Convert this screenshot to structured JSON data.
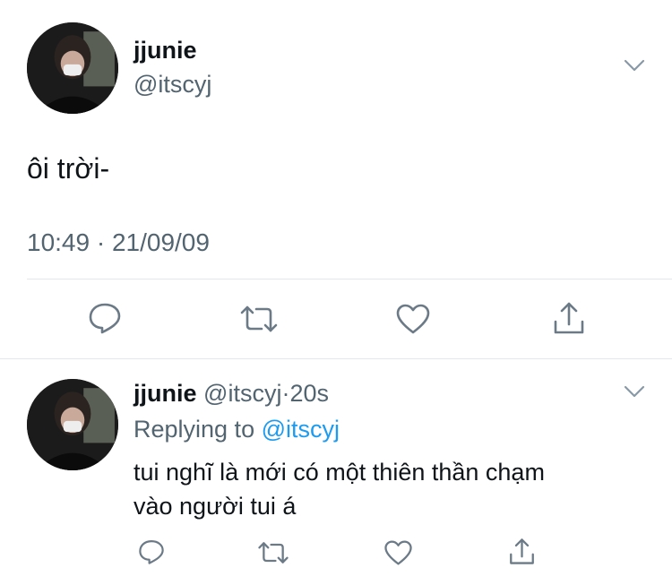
{
  "tweet": {
    "display_name": "jjunie",
    "handle": "@itscyj",
    "text": "ôi trời-",
    "timestamp": "10:49 · 21/09/09",
    "actions": [
      "reply-icon",
      "retweet-icon",
      "like-icon",
      "share-icon"
    ]
  },
  "reply": {
    "display_name": "jjunie",
    "handle": "@itscyj",
    "separator": "·",
    "time_ago": "20s",
    "replying_prefix": "Replying to",
    "replying_to": "@itscyj",
    "text_line1": "tui nghĩ là mới có một thiên thần chạm",
    "text_line2": "vào người tui á",
    "actions": [
      "reply-icon",
      "retweet-icon",
      "like-icon",
      "share-icon"
    ]
  },
  "colors": {
    "accent": "#1d9bf0",
    "muted": "#536471",
    "icon": "#6b7a86",
    "divider": "#e1e8ed"
  }
}
